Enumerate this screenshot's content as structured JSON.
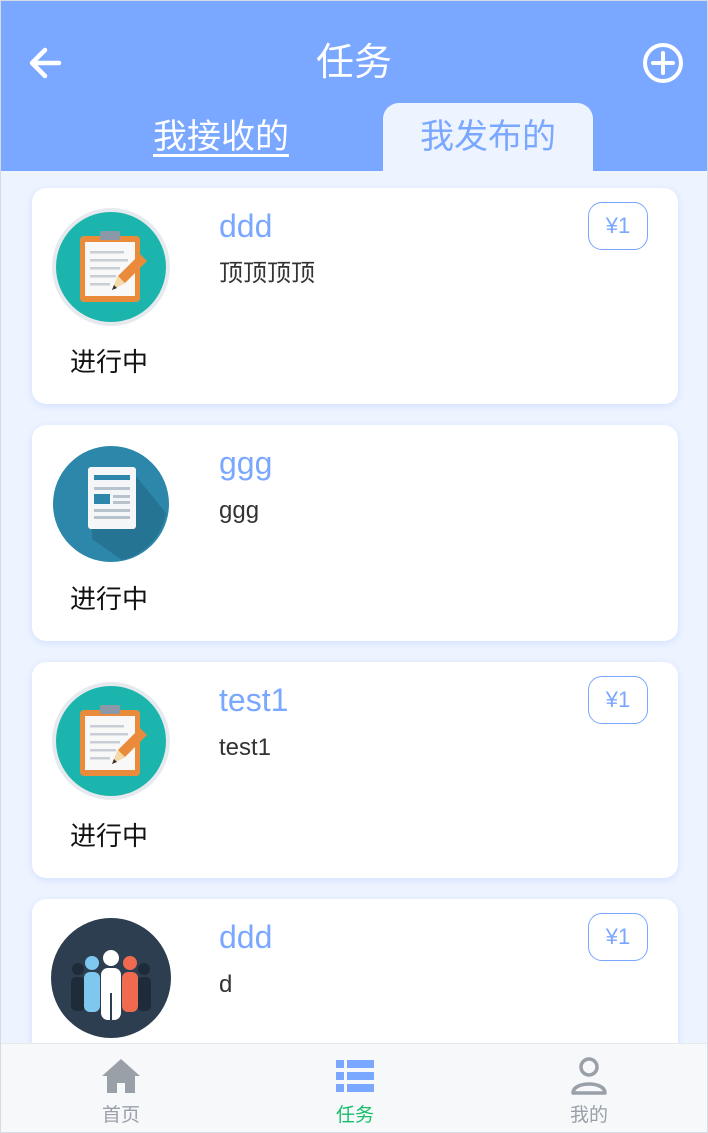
{
  "header": {
    "title": "任务",
    "back_icon": "arrow-left-icon",
    "add_icon": "plus-circle-icon",
    "tabs": [
      {
        "label": "我接收的",
        "active": false
      },
      {
        "label": "我发布的",
        "active": true
      }
    ]
  },
  "tasks": [
    {
      "title": "ddd",
      "description": "顶顶顶顶",
      "status": "进行中",
      "price": "¥1",
      "icon": "clipboard-icon"
    },
    {
      "title": "ggg",
      "description": "ggg",
      "status": "进行中",
      "price": "",
      "icon": "document-icon"
    },
    {
      "title": "test1",
      "description": "test1",
      "status": "进行中",
      "price": "¥1",
      "icon": "clipboard-icon"
    },
    {
      "title": "ddd",
      "description": "d",
      "status": "",
      "price": "¥1",
      "icon": "people-icon"
    }
  ],
  "bottom_nav": [
    {
      "label": "首页",
      "icon": "home-icon",
      "active": false
    },
    {
      "label": "任务",
      "icon": "list-icon",
      "active": true
    },
    {
      "label": "我的",
      "icon": "user-icon",
      "active": false
    }
  ],
  "colors": {
    "primary": "#7aa7ff",
    "background": "#eef4ff",
    "active_nav": "#19be6b",
    "inactive_nav": "#9aa0a8"
  }
}
